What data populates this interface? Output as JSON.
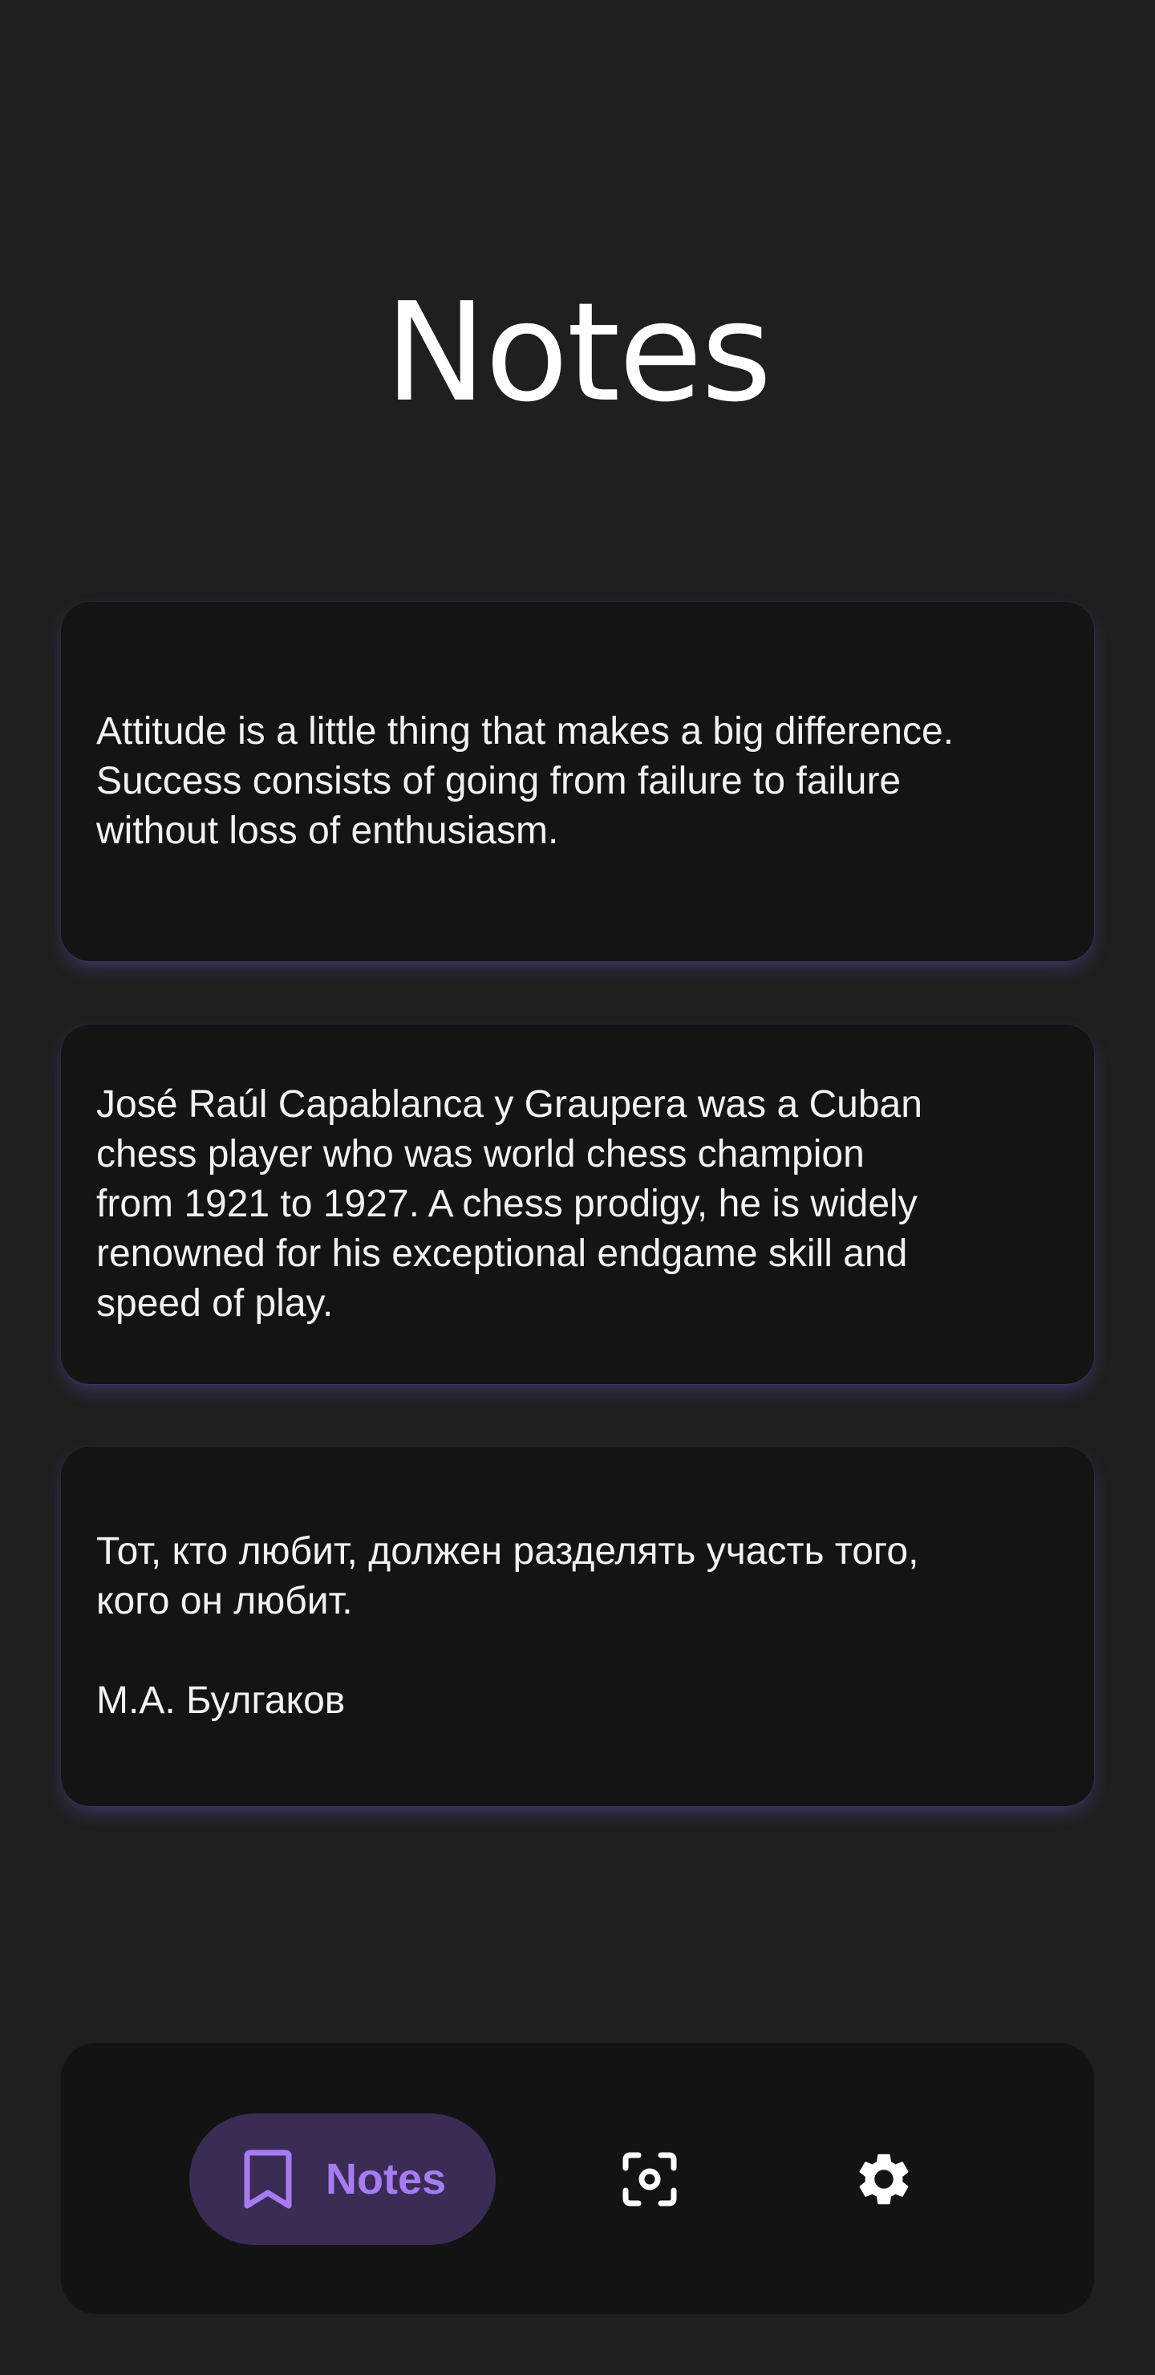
{
  "page": {
    "title": "Notes"
  },
  "notes": [
    {
      "text": "Attitude is a little thing that makes a big difference.\nSuccess consists of going from failure to failure\nwithout loss of enthusiasm."
    },
    {
      "text": "José Raúl Capablanca y Graupera was a Cuban\nchess player who was world chess champion\nfrom 1921 to 1927. A chess prodigy, he is widely\nrenowned for his exceptional endgame skill and\nspeed of play."
    },
    {
      "text": "Тот, кто любит, должен разделять участь того,\nкого он любит.\n\nМ.А. Булгаков"
    }
  ],
  "bottom_nav": {
    "items": [
      {
        "label": "Notes",
        "icon": "bookmark-icon",
        "active": true
      },
      {
        "label": "",
        "icon": "capture-icon",
        "active": false
      },
      {
        "label": "",
        "icon": "gear-icon",
        "active": false
      }
    ]
  },
  "colors": {
    "background": "#1f1f1f",
    "card": "#141414",
    "accent": "#a77cf2",
    "accent_container": "#3a2c55"
  }
}
